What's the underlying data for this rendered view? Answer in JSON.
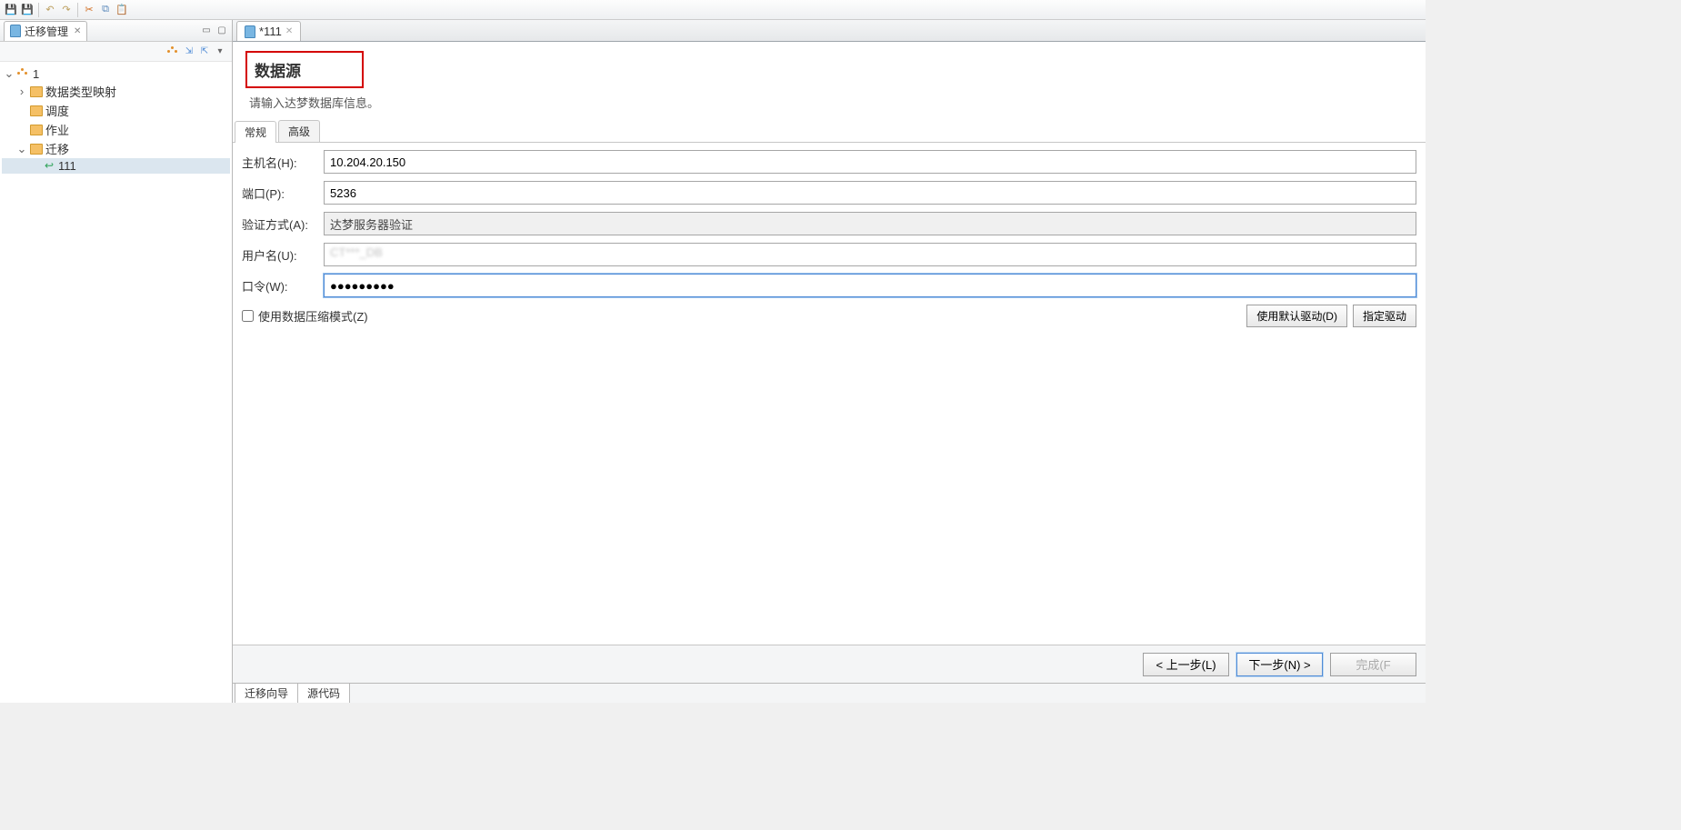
{
  "toolbar_icons": [
    "save",
    "save-all",
    "",
    "undo",
    "redo",
    "",
    "cut",
    "copy",
    "paste"
  ],
  "left_panel": {
    "tab_label": "迁移管理",
    "tree_root": "1",
    "items": [
      "数据类型映射",
      "调度",
      "作业",
      "迁移"
    ],
    "child_item": "111"
  },
  "editor_tab": "*111",
  "header": {
    "title": "数据源",
    "subtitle": "请输入达梦数据库信息。"
  },
  "inner_tabs": [
    "常规",
    "高级"
  ],
  "form": {
    "host_label": "主机名(H):",
    "host_value": "10.204.20.150",
    "port_label": "端口(P):",
    "port_value": "5236",
    "auth_label": "验证方式(A):",
    "auth_value": "达梦服务器验证",
    "user_label": "用户名(U):",
    "user_value": "CT***_DB",
    "pwd_label": "口令(W):",
    "pwd_value": "●●●●●●●●●",
    "compress_label": "使用数据压缩模式(Z)",
    "default_driver": "使用默认驱动(D)",
    "specify_driver": "指定驱动"
  },
  "wizard": {
    "prev": "< 上一步(L)",
    "next": "下一步(N) >",
    "finish": "完成(F"
  },
  "bottom_tabs": [
    "迁移向导",
    "源代码"
  ]
}
